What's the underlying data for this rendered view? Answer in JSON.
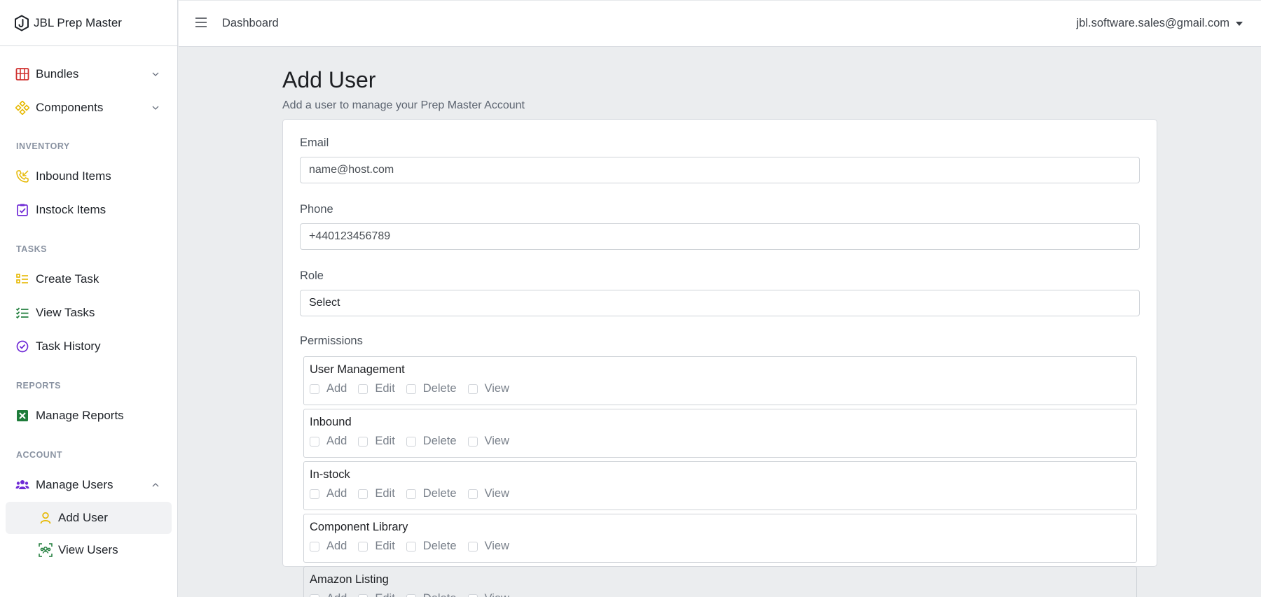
{
  "brand": {
    "name": "JBL Prep Master",
    "icon": "hexagon-j-logo"
  },
  "header": {
    "breadcrumb": "Dashboard",
    "user_email": "jbl.software.sales@gmail.com"
  },
  "sidebar": {
    "items": [
      {
        "label": "Bundles",
        "icon": "bundles-icon",
        "color": "#d0302f"
      },
      {
        "label": "Components",
        "icon": "components-icon",
        "color": "#e6b800"
      }
    ],
    "sections": [
      {
        "title": "INVENTORY",
        "items": [
          {
            "label": "Inbound Items",
            "icon": "inbound-icon",
            "color": "#e6b800"
          },
          {
            "label": "Instock Items",
            "icon": "instock-icon",
            "color": "#6f2ad6"
          }
        ]
      },
      {
        "title": "TASKS",
        "items": [
          {
            "label": "Create Task",
            "icon": "create-task-icon",
            "color": "#e6b800"
          },
          {
            "label": "View Tasks",
            "icon": "view-tasks-icon",
            "color": "#1e7c3a"
          },
          {
            "label": "Task History",
            "icon": "task-history-icon",
            "color": "#6f2ad6"
          }
        ]
      },
      {
        "title": "REPORTS",
        "items": [
          {
            "label": "Manage Reports",
            "icon": "excel-icon",
            "color": "#1e7c3a"
          }
        ]
      },
      {
        "title": "ACCOUNT",
        "items": [
          {
            "label": "Manage Users",
            "icon": "users-icon",
            "color": "#6f2ad6"
          }
        ]
      }
    ],
    "sub_items": [
      {
        "label": "Add User",
        "icon": "user-icon",
        "color": "#e6b800"
      },
      {
        "label": "View Users",
        "icon": "view-users-icon",
        "color": "#1e7c3a"
      }
    ]
  },
  "page": {
    "title": "Add User",
    "subtitle": "Add a user to manage your Prep Master Account"
  },
  "form": {
    "email_label": "Email",
    "email_placeholder": "name@host.com",
    "phone_label": "Phone",
    "phone_placeholder": "+440123456789",
    "role_label": "Role",
    "role_value": "Select",
    "permissions_label": "Permissions",
    "options": [
      "Add",
      "Edit",
      "Delete",
      "View"
    ],
    "permission_groups": [
      "User Management",
      "Inbound",
      "In-stock",
      "Component Library",
      "Amazon Listing"
    ]
  }
}
